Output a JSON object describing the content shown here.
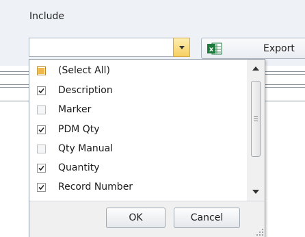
{
  "toolbar": {
    "include_label": "Include",
    "combo_value": "",
    "export_label": "Export",
    "excel_icon_letter": "x"
  },
  "dropdown": {
    "items": [
      {
        "label": "(Select All)",
        "state": "indeterminate"
      },
      {
        "label": "Description",
        "state": "checked"
      },
      {
        "label": "Marker",
        "state": "unchecked"
      },
      {
        "label": "PDM Qty",
        "state": "checked"
      },
      {
        "label": "Qty Manual",
        "state": "unchecked"
      },
      {
        "label": "Quantity",
        "state": "checked"
      },
      {
        "label": "Record Number",
        "state": "checked"
      }
    ],
    "ok_label": "OK",
    "cancel_label": "Cancel"
  },
  "colors": {
    "accent_gold": "#f7cf63",
    "excel_green": "#1e7a3c",
    "top_band": "#eef1f6"
  }
}
